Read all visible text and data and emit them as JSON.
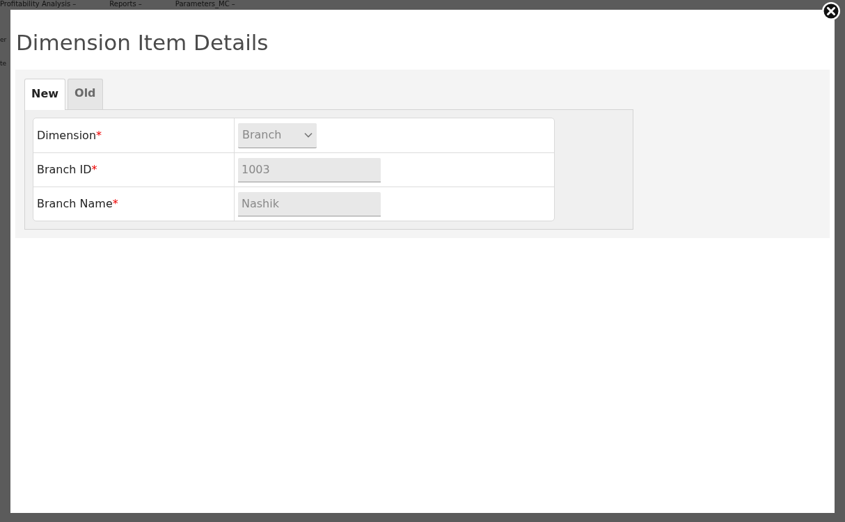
{
  "background_page": {
    "nav_items": [
      "Profitability Analysis –",
      "Reports –",
      "Parameters_MC –"
    ],
    "fragments": [
      "er",
      "te"
    ]
  },
  "dialog": {
    "title": "Dimension Item Details",
    "tabs": [
      {
        "label": "New",
        "selected": true
      },
      {
        "label": "Old",
        "selected": false
      }
    ],
    "fields": [
      {
        "label": "Dimension",
        "required_mark": "*",
        "kind": "select",
        "value": "Branch",
        "disabled": true
      },
      {
        "label": "Branch ID",
        "required_mark": "*",
        "kind": "text",
        "value": "1003",
        "disabled": true
      },
      {
        "label": "Branch Name",
        "required_mark": "*",
        "kind": "text",
        "value": "Nashik",
        "disabled": true
      }
    ]
  }
}
